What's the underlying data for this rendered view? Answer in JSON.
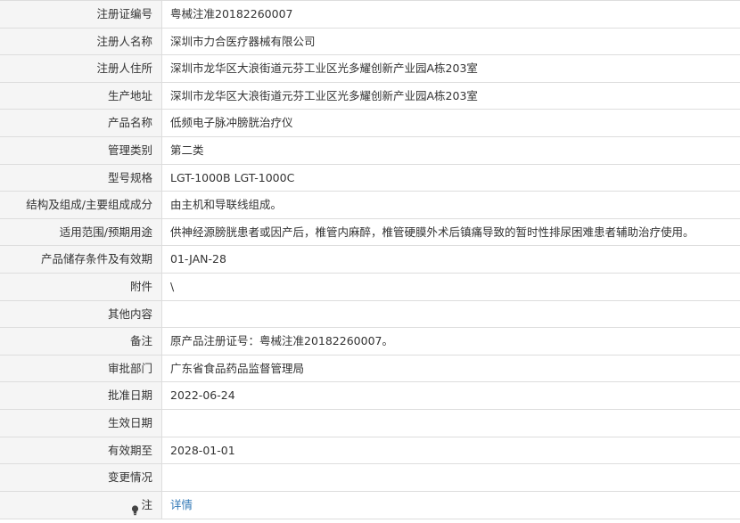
{
  "rows": [
    {
      "label": "注册证编号",
      "value": "粤械注准20182260007"
    },
    {
      "label": "注册人名称",
      "value": "深圳市力合医疗器械有限公司"
    },
    {
      "label": "注册人住所",
      "value": "深圳市龙华区大浪街道元芬工业区光多耀创新产业园A栋203室"
    },
    {
      "label": "生产地址",
      "value": "深圳市龙华区大浪街道元芬工业区光多耀创新产业园A栋203室"
    },
    {
      "label": "产品名称",
      "value": "低频电子脉冲膀胱治疗仪"
    },
    {
      "label": "管理类别",
      "value": "第二类"
    },
    {
      "label": "型号规格",
      "value": "LGT-1000B LGT-1000C"
    },
    {
      "label": "结构及组成/主要组成成分",
      "value": "由主机和导联线组成。"
    },
    {
      "label": "适用范围/预期用途",
      "value": "供神经源膀胱患者或因产后，椎管内麻醉，椎管硬膜外术后镇痛导致的暂时性排尿困难患者辅助治疗使用。"
    },
    {
      "label": "产品储存条件及有效期",
      "value": "01-JAN-28"
    },
    {
      "label": "附件",
      "value": "\\"
    },
    {
      "label": "其他内容",
      "value": ""
    },
    {
      "label": "备注",
      "value": "原产品注册证号：粤械注准20182260007。"
    },
    {
      "label": "审批部门",
      "value": "广东省食品药品监督管理局"
    },
    {
      "label": "批准日期",
      "value": "2022-06-24"
    },
    {
      "label": "生效日期",
      "value": ""
    },
    {
      "label": "有效期至",
      "value": "2028-01-01"
    },
    {
      "label": "变更情况",
      "value": ""
    }
  ],
  "note": {
    "label": "注",
    "icon": "lightbulb-icon",
    "link_text": "详情"
  },
  "colors": {
    "label_bg": "#f5f5f5",
    "border": "#dddddd",
    "text": "#333333",
    "link": "#337ab7"
  }
}
